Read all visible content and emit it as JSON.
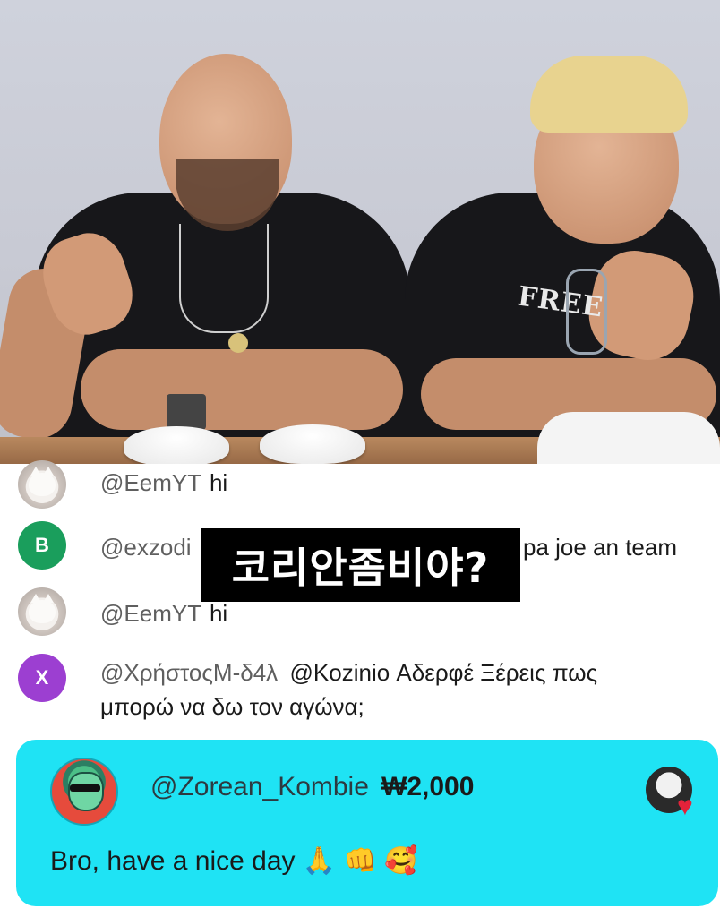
{
  "chat": {
    "messages": [
      {
        "author": "@EemYT",
        "text": "hi",
        "avatar": "cat-avatar"
      },
      {
        "author": "@exzodi",
        "text": "pa joe an team",
        "avatar_letter": "B",
        "avatar_color": "#1a9e5c"
      },
      {
        "author": "@EemYT",
        "text": "hi",
        "avatar": "cat-avatar"
      },
      {
        "author": "@ΧρήστοςΜ-δ4λ",
        "text_line1": "@Kozinio Αδερφέ Ξέρεις πως",
        "text_line2": "μπορώ να δω τον αγώνα;",
        "avatar_letter": "X",
        "avatar_color": "#9c3fd1"
      }
    ]
  },
  "subtitle": "코리안좀비야?",
  "superchat": {
    "author": "@Zorean_Kombie",
    "amount": "₩2,000",
    "text": "Bro, have a nice day",
    "emojis": [
      "🙏",
      "👊",
      "🥰"
    ],
    "background": "#1fe3f4"
  },
  "video": {
    "shirt_text": "FREE"
  }
}
